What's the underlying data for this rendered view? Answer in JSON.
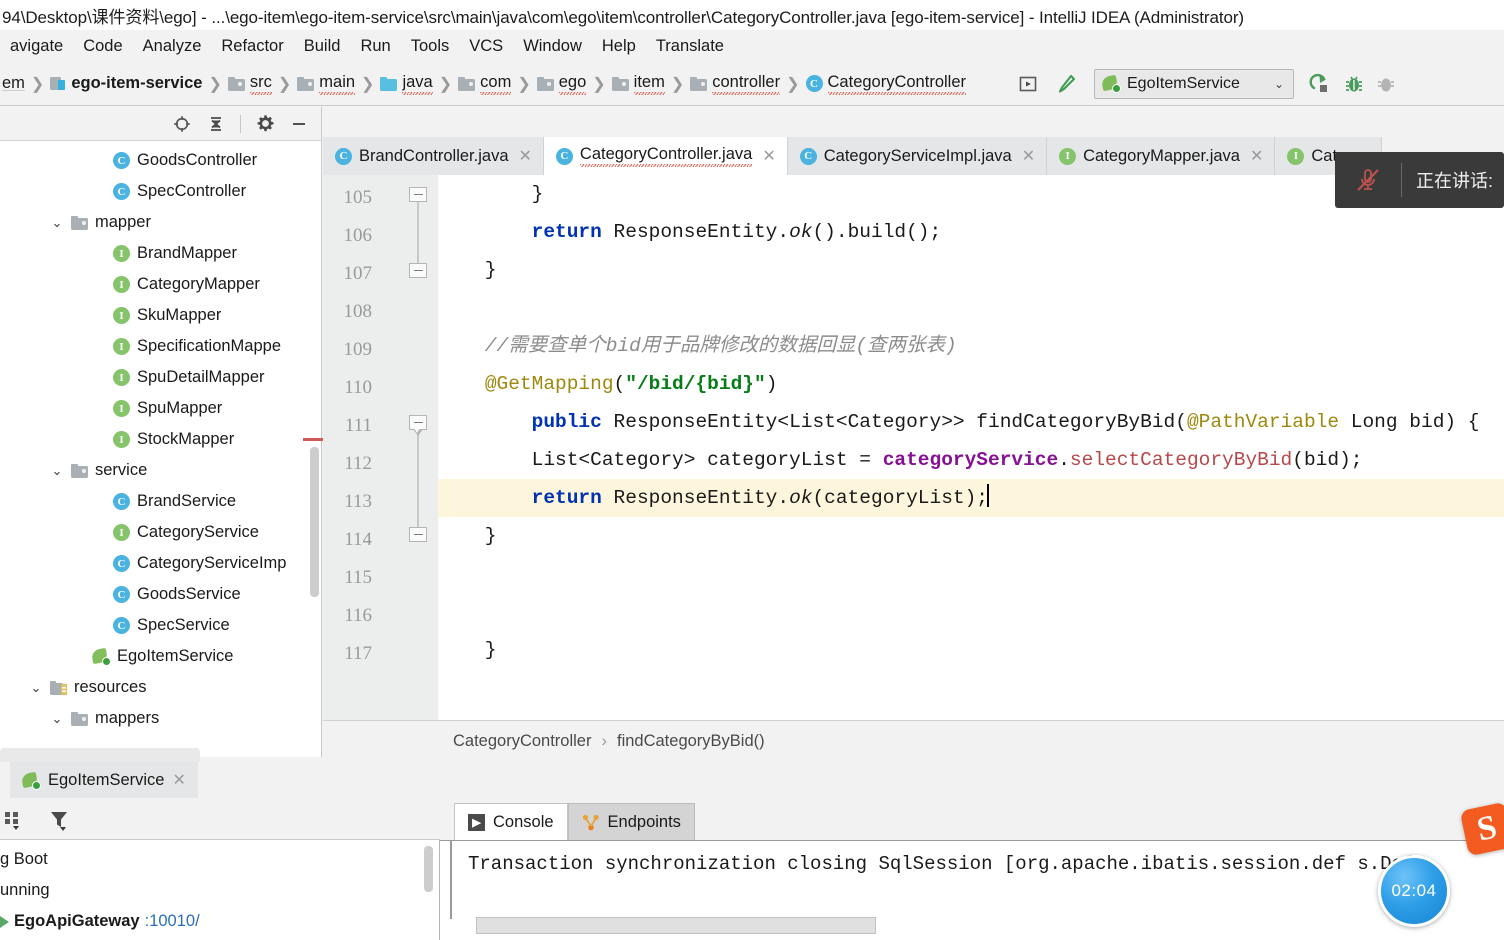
{
  "window": {
    "title": "94\\Desktop\\课件资料\\ego] - ...\\ego-item\\ego-item-service\\src\\main\\java\\com\\ego\\item\\controller\\CategoryController.java [ego-item-service] - IntelliJ IDEA (Administrator)"
  },
  "menubar": {
    "items": [
      {
        "label": "avigate"
      },
      {
        "label": "Code"
      },
      {
        "label": "Analyze"
      },
      {
        "label": "Refactor"
      },
      {
        "label": "Build"
      },
      {
        "label": "Run"
      },
      {
        "label": "Tools"
      },
      {
        "label": "VCS"
      },
      {
        "label": "Window"
      },
      {
        "label": "Help"
      },
      {
        "label": "Translate"
      }
    ]
  },
  "navbar": {
    "crumbs": [
      {
        "label": "em",
        "icon": "none"
      },
      {
        "label": "ego-item-service",
        "icon": "module-icon",
        "bold": true
      },
      {
        "label": "src",
        "icon": "folder-gray-icon",
        "squiggle": true
      },
      {
        "label": "main",
        "icon": "folder-gray-icon",
        "squiggle": true
      },
      {
        "label": "java",
        "icon": "folder-blue-icon",
        "squiggle": true
      },
      {
        "label": "com",
        "icon": "folder-gray-icon",
        "squiggle": true
      },
      {
        "label": "ego",
        "icon": "folder-gray-icon",
        "squiggle": true
      },
      {
        "label": "item",
        "icon": "folder-gray-icon",
        "squiggle": true
      },
      {
        "label": "controller",
        "icon": "folder-gray-icon",
        "squiggle": true
      },
      {
        "label": "CategoryController",
        "icon": "class-icon",
        "squiggle": true
      }
    ],
    "run_config": {
      "label": "EgoItemService",
      "chevron": "⌄"
    },
    "buttons": [
      {
        "name": "run-button",
        "glyph": "▶"
      },
      {
        "name": "build-hammer-button",
        "glyph": "hammer"
      },
      {
        "name": "rerun-button",
        "glyph": "rerun"
      },
      {
        "name": "debug-button",
        "glyph": "bug"
      },
      {
        "name": "coverage-button",
        "glyph": "coverage"
      }
    ]
  },
  "project_pane": {
    "toolbar": [
      {
        "name": "locate-icon",
        "glyph": "⊕"
      },
      {
        "name": "collapse-all-icon",
        "glyph": "collapse"
      },
      {
        "name": "settings-gear-icon",
        "glyph": "gear"
      },
      {
        "name": "hide-icon",
        "glyph": "—"
      }
    ],
    "tree": [
      {
        "label": "GoodsController",
        "kind": "class",
        "indent": 4,
        "chevron": ""
      },
      {
        "label": "SpecController",
        "kind": "class",
        "indent": 4,
        "chevron": ""
      },
      {
        "label": "mapper",
        "kind": "folder",
        "indent": 2,
        "chevron": "⌄"
      },
      {
        "label": "BrandMapper",
        "kind": "interface",
        "indent": 4,
        "chevron": ""
      },
      {
        "label": "CategoryMapper",
        "kind": "interface",
        "indent": 4,
        "chevron": ""
      },
      {
        "label": "SkuMapper",
        "kind": "interface",
        "indent": 4,
        "chevron": ""
      },
      {
        "label": "SpecificationMappe",
        "kind": "interface",
        "indent": 4,
        "chevron": ""
      },
      {
        "label": "SpuDetailMapper",
        "kind": "interface",
        "indent": 4,
        "chevron": ""
      },
      {
        "label": "SpuMapper",
        "kind": "interface",
        "indent": 4,
        "chevron": ""
      },
      {
        "label": "StockMapper",
        "kind": "interface",
        "indent": 4,
        "chevron": ""
      },
      {
        "label": "service",
        "kind": "folder",
        "indent": 2,
        "chevron": "⌄"
      },
      {
        "label": "BrandService",
        "kind": "class",
        "indent": 4,
        "chevron": ""
      },
      {
        "label": "CategoryService",
        "kind": "interface",
        "indent": 4,
        "chevron": ""
      },
      {
        "label": "CategoryServiceImp",
        "kind": "class",
        "indent": 4,
        "chevron": ""
      },
      {
        "label": "GoodsService",
        "kind": "class",
        "indent": 4,
        "chevron": ""
      },
      {
        "label": "SpecService",
        "kind": "class",
        "indent": 4,
        "chevron": ""
      },
      {
        "label": "EgoItemService",
        "kind": "spring",
        "indent": 3,
        "chevron": ""
      },
      {
        "label": "resources",
        "kind": "resources",
        "indent": 1,
        "chevron": "⌄"
      },
      {
        "label": "mappers",
        "kind": "folder",
        "indent": 2,
        "chevron": "⌄"
      }
    ]
  },
  "editor_tabs": [
    {
      "label": "BrandController.java",
      "kind": "class",
      "active": false,
      "close": "✕"
    },
    {
      "label": "CategoryController.java",
      "kind": "class",
      "active": true,
      "close": "✕"
    },
    {
      "label": "CategoryServiceImpl.java",
      "kind": "class",
      "active": false,
      "close": "✕"
    },
    {
      "label": "CategoryMapper.java",
      "kind": "interface",
      "active": false,
      "close": "✕"
    },
    {
      "label": "Categor",
      "kind": "interface",
      "active": false,
      "close": ""
    }
  ],
  "editor": {
    "line_numbers": [
      "105",
      "106",
      "107",
      "108",
      "109",
      "110",
      "111",
      "112",
      "113",
      "114",
      "115",
      "116",
      "117"
    ],
    "highlighted_line": "113",
    "lines": [
      {
        "num": "105",
        "tokens": [
          {
            "t": "        }",
            "c": "plain"
          }
        ]
      },
      {
        "num": "106",
        "tokens": [
          {
            "t": "        ",
            "c": "plain"
          },
          {
            "t": "return",
            "c": "kw"
          },
          {
            "t": " ResponseEntity.",
            "c": "plain"
          },
          {
            "t": "ok",
            "c": "static"
          },
          {
            "t": "().build();",
            "c": "plain"
          }
        ]
      },
      {
        "num": "107",
        "tokens": [
          {
            "t": "    }",
            "c": "plain"
          }
        ]
      },
      {
        "num": "108",
        "tokens": []
      },
      {
        "num": "109",
        "tokens": [
          {
            "t": "    //需要查单个bid用于品牌修改的数据回显(查两张表)",
            "c": "cmt"
          }
        ]
      },
      {
        "num": "110",
        "tokens": [
          {
            "t": "    ",
            "c": "plain"
          },
          {
            "t": "@GetMapping",
            "c": "anno"
          },
          {
            "t": "(",
            "c": "plain"
          },
          {
            "t": "\"/bid/{bid}\"",
            "c": "str"
          },
          {
            "t": ")",
            "c": "plain"
          }
        ]
      },
      {
        "num": "111",
        "tokens": [
          {
            "t": "        ",
            "c": "plain"
          },
          {
            "t": "public",
            "c": "kw"
          },
          {
            "t": " ResponseEntity<List<Category>> findCategoryByBid(",
            "c": "plain"
          },
          {
            "t": "@PathVariable",
            "c": "anno"
          },
          {
            "t": " Long bid) {",
            "c": "plain"
          }
        ]
      },
      {
        "num": "112",
        "tokens": [
          {
            "t": "        List<Category> categoryList = ",
            "c": "plain"
          },
          {
            "t": "categoryService",
            "c": "field"
          },
          {
            "t": ".",
            "c": "plain"
          },
          {
            "t": "selectCategoryByBid",
            "c": "meth"
          },
          {
            "t": "(bid);",
            "c": "plain"
          }
        ]
      },
      {
        "num": "113",
        "tokens": [
          {
            "t": "        ",
            "c": "plain"
          },
          {
            "t": "return",
            "c": "kw"
          },
          {
            "t": " ResponseEntity.",
            "c": "plain"
          },
          {
            "t": "ok",
            "c": "static"
          },
          {
            "t": "(categoryList);",
            "c": "plain"
          }
        ]
      },
      {
        "num": "114",
        "tokens": [
          {
            "t": "    }",
            "c": "plain"
          }
        ]
      },
      {
        "num": "115",
        "tokens": []
      },
      {
        "num": "116",
        "tokens": []
      },
      {
        "num": "117",
        "tokens": [
          {
            "t": "    }",
            "c": "plain"
          }
        ]
      }
    ],
    "breadcrumb": {
      "class": "CategoryController",
      "separator": "›",
      "method": "findCategoryByBid()"
    }
  },
  "run_window": {
    "tab": {
      "label": "EgoItemService",
      "close": "✕"
    },
    "toolbar": [
      {
        "name": "show-as-tree-icon",
        "glyph": "tree"
      },
      {
        "name": "filter-icon",
        "glyph": "filter"
      }
    ],
    "left_lines": [
      {
        "text": "g Boot",
        "bold": false
      },
      {
        "text": "unning",
        "bold": false
      },
      {
        "text": "EgoApiGateway",
        "bold": true,
        "port": ":10010/"
      }
    ]
  },
  "console": {
    "tabs": [
      {
        "label": "Console",
        "icon": "console-run-icon",
        "active": true
      },
      {
        "label": "Endpoints",
        "icon": "endpoints-icon",
        "active": false
      }
    ],
    "output": "Transaction synchronization closing SqlSession [org.apache.ibatis.session.def    s.Defa"
  },
  "overlays": {
    "mic_toast": {
      "label": "正在讲话:",
      "icon": "mic-muted-icon"
    },
    "timer": {
      "value": "02:04"
    },
    "sogou": {
      "glyph": "S"
    }
  },
  "colors": {
    "accent_blue": "#4ab3e0",
    "interface_green": "#86c46b",
    "spring_green": "#6db33f",
    "keyword_blue": "#0033b3",
    "string_green": "#067d17",
    "annotation_olive": "#9e880d",
    "field_purple": "#871094",
    "method_red": "#b8474a",
    "highlight_yellow": "#fdf6dd"
  }
}
